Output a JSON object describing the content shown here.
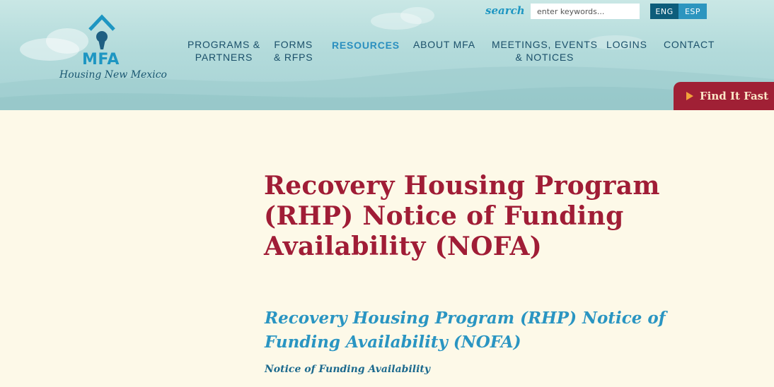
{
  "header": {
    "logo": {
      "brand": "MFA",
      "tagline": "Housing New Mexico"
    },
    "search": {
      "label": "search",
      "placeholder": "enter keywords..."
    },
    "languages": [
      "ENG",
      "ESP"
    ],
    "nav": [
      {
        "label": "PROGRAMS &\nPARTNERS"
      },
      {
        "label": "FORMS\n& RFPs"
      },
      {
        "label": "RESOURCES"
      },
      {
        "label": "ABOUT MFA"
      },
      {
        "label": "MEETINGS, EVENTS\n& NOTICES"
      },
      {
        "label": "LOGINS"
      },
      {
        "label": "CONTACT"
      }
    ],
    "find_fast": "Find It Fast"
  },
  "main": {
    "title": "Recovery Housing Program (RHP) Notice of Funding Availability (NOFA)",
    "subtitle": "Recovery Housing Program (RHP) Notice of Funding Availability (NOFA)",
    "note": "Notice of Funding Availability"
  },
  "colors": {
    "title": "#a01d36",
    "link": "#2a95c2",
    "nav": "#1a4f69",
    "accent_button": "#a02035",
    "background": "#fdf9e8"
  }
}
